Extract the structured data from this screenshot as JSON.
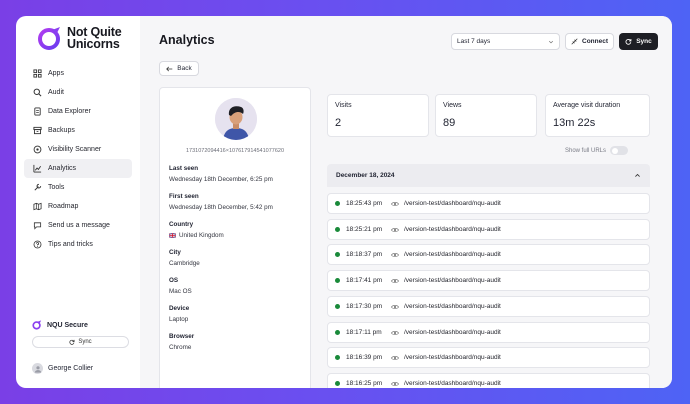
{
  "brand": {
    "name_line1": "Not Quite",
    "name_line2": "Unicorns",
    "accent": "#8a3ff0"
  },
  "sidebar": {
    "items": [
      {
        "label": "Apps",
        "icon": "grid-icon"
      },
      {
        "label": "Audit",
        "icon": "magnifier-icon"
      },
      {
        "label": "Data Explorer",
        "icon": "document-icon"
      },
      {
        "label": "Backups",
        "icon": "archive-icon"
      },
      {
        "label": "Visibility Scanner",
        "icon": "eye-scan-icon"
      },
      {
        "label": "Analytics",
        "icon": "chart-icon"
      },
      {
        "label": "Tools",
        "icon": "wrench-icon"
      },
      {
        "label": "Roadmap",
        "icon": "map-icon"
      },
      {
        "label": "Send us a message",
        "icon": "chat-icon"
      },
      {
        "label": "Tips and tricks",
        "icon": "help-icon"
      }
    ],
    "active_index": 5,
    "secure_label": "NQU Secure",
    "sync_label": "Sync",
    "user_name": "George Collier"
  },
  "header": {
    "title": "Analytics",
    "range_value": "Last 7 days",
    "connect_label": "Connect",
    "sync_label": "Sync",
    "back_label": "Back"
  },
  "profile": {
    "uid": "1731072094416×107617914541077620",
    "fields": [
      {
        "label": "Last seen",
        "value": "Wednesday 18th December, 6:25 pm"
      },
      {
        "label": "First seen",
        "value": "Wednesday 18th December, 5:42 pm"
      },
      {
        "label": "Country",
        "value": "United Kingdom",
        "flag": true
      },
      {
        "label": "City",
        "value": "Cambridge"
      },
      {
        "label": "OS",
        "value": "Mac OS"
      },
      {
        "label": "Device",
        "value": "Laptop"
      },
      {
        "label": "Browser",
        "value": "Chrome"
      }
    ]
  },
  "stats": [
    {
      "label": "Visits",
      "value": "2"
    },
    {
      "label": "Views",
      "value": "89"
    },
    {
      "label": "Average visit duration",
      "value": "13m 22s"
    }
  ],
  "show_urls_label": "Show full URLs",
  "date_group": "December 18, 2024",
  "visits": [
    {
      "time": "18:25:43 pm",
      "path": "/version-test/dashboard/nqu-audit"
    },
    {
      "time": "18:25:21 pm",
      "path": "/version-test/dashboard/nqu-audit"
    },
    {
      "time": "18:18:37 pm",
      "path": "/version-test/dashboard/nqu-audit"
    },
    {
      "time": "18:17:41 pm",
      "path": "/version-test/dashboard/nqu-audit"
    },
    {
      "time": "18:17:30 pm",
      "path": "/version-test/dashboard/nqu-audit"
    },
    {
      "time": "18:17:11 pm",
      "path": "/version-test/dashboard/nqu-audit"
    },
    {
      "time": "18:16:39 pm",
      "path": "/version-test/dashboard/nqu-audit"
    },
    {
      "time": "18:16:25 pm",
      "path": "/version-test/dashboard/nqu-audit"
    }
  ]
}
